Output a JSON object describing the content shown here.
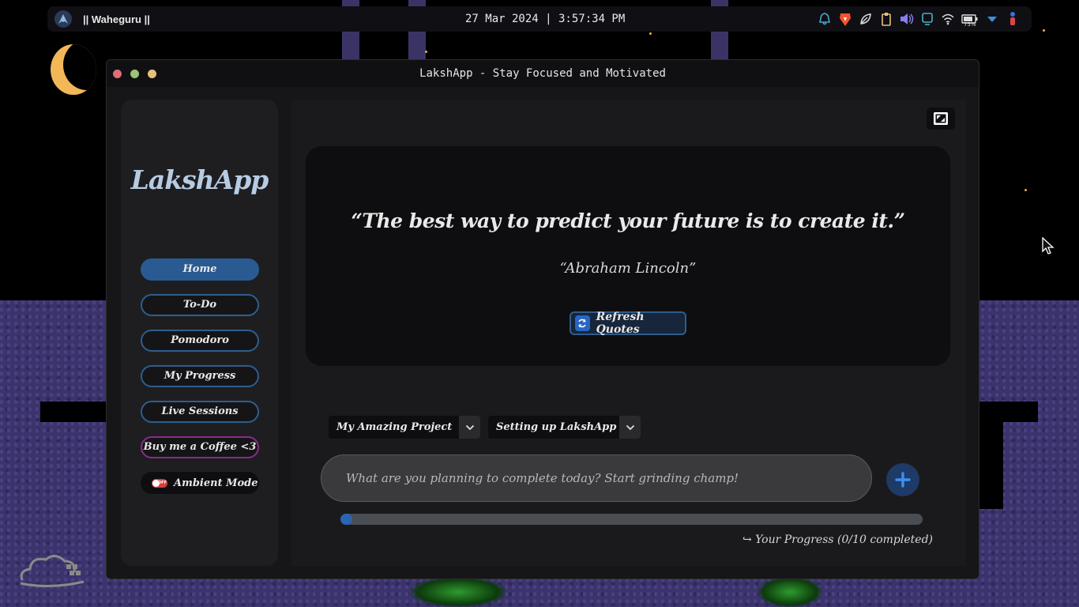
{
  "topbar": {
    "workspace_label": "|| Waheguru ||",
    "clock": "27 Mar 2024 | 3:57:34 PM",
    "battery_percent": "75%",
    "tray_icons": [
      "notification-bell-icon",
      "brave-browser-icon",
      "leaf-icon",
      "clipboard-icon",
      "volume-icon",
      "display-icon",
      "wifi-icon",
      "battery-icon",
      "dropdown-arrow-icon",
      "user-icon"
    ]
  },
  "window": {
    "title": "LakshApp - Stay Focused and Motivated"
  },
  "sidebar": {
    "brand": "LakshApp",
    "items": [
      {
        "label": "Home",
        "active": true
      },
      {
        "label": "To-Do"
      },
      {
        "label": "Pomodoro"
      },
      {
        "label": "My Progress"
      },
      {
        "label": "Live Sessions"
      },
      {
        "label": "Buy me a Coffee <3"
      }
    ],
    "ambient": {
      "label": "Ambient Mode",
      "state": "OFF"
    }
  },
  "quote": {
    "text": "“The best way to predict your future is to create it.”",
    "author": "“Abraham Lincoln”",
    "refresh_label": "Refresh Quotes"
  },
  "tasks": {
    "project_select": "My Amazing Project",
    "task_select": "Setting up LakshApp",
    "input_placeholder": "What are you planning to complete today? Start grinding champ!",
    "progress_fraction": 0.02,
    "progress_label": "↪ Your Progress (0/10 completed)"
  },
  "colors": {
    "accent": "#2a5a92",
    "coffee_border": "#8b2a8f",
    "progress_fill": "#2a64b4"
  }
}
